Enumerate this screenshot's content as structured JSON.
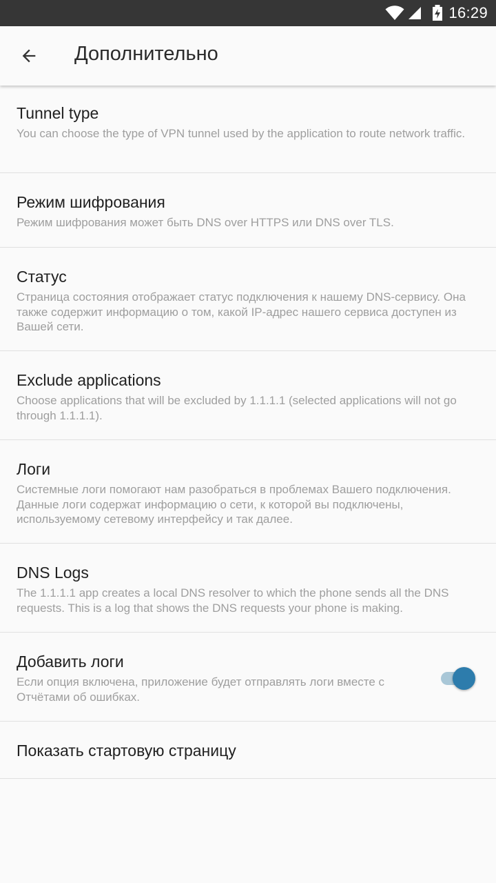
{
  "status_bar": {
    "time": "16:29",
    "icons": [
      "wifi-icon",
      "signal-icon",
      "battery-charging-icon"
    ]
  },
  "header": {
    "back_icon": "arrow-back-icon",
    "title": "Дополнительно"
  },
  "settings": [
    {
      "title": "Tunnel type",
      "summary": "You can choose the type of VPN tunnel used by the application to route network traffic."
    },
    {
      "title": "Режим шифрования",
      "summary": "Режим шифрования может быть DNS over HTTPS или DNS over TLS."
    },
    {
      "title": "Статус",
      "summary": "Страница состояния отображает статус подключения к нашему DNS-сервису. Она также содержит информацию о том, какой IP-адрес нашего сервиса доступен из Вашей сети."
    },
    {
      "title": "Exclude applications",
      "summary": "Choose applications that will be excluded by 1.1.1.1 (selected applications will not go through 1.1.1.1)."
    },
    {
      "title": "Логи",
      "summary": "Системные логи помогают нам разобраться в проблемах Вашего подключения. Данные логи содержат информацию о сети, к которой вы подключены, используемому сетевому интерфейсу и так далее."
    },
    {
      "title": "DNS Logs",
      "summary": "The 1.1.1.1 app creates a local DNS resolver to which the phone sends all the DNS requests. This is a log that shows the DNS requests your phone is making."
    },
    {
      "title": "Добавить логи",
      "summary": "Если опция включена, приложение будет отправлять логи вместе с Отчётами об ошибках.",
      "toggle_on": true
    },
    {
      "title": "Показать стартовую страницу"
    }
  ],
  "colors": {
    "toggle_thumb": "#2d7cac",
    "toggle_track": "#a9c7d7",
    "status_bar": "#363636"
  }
}
